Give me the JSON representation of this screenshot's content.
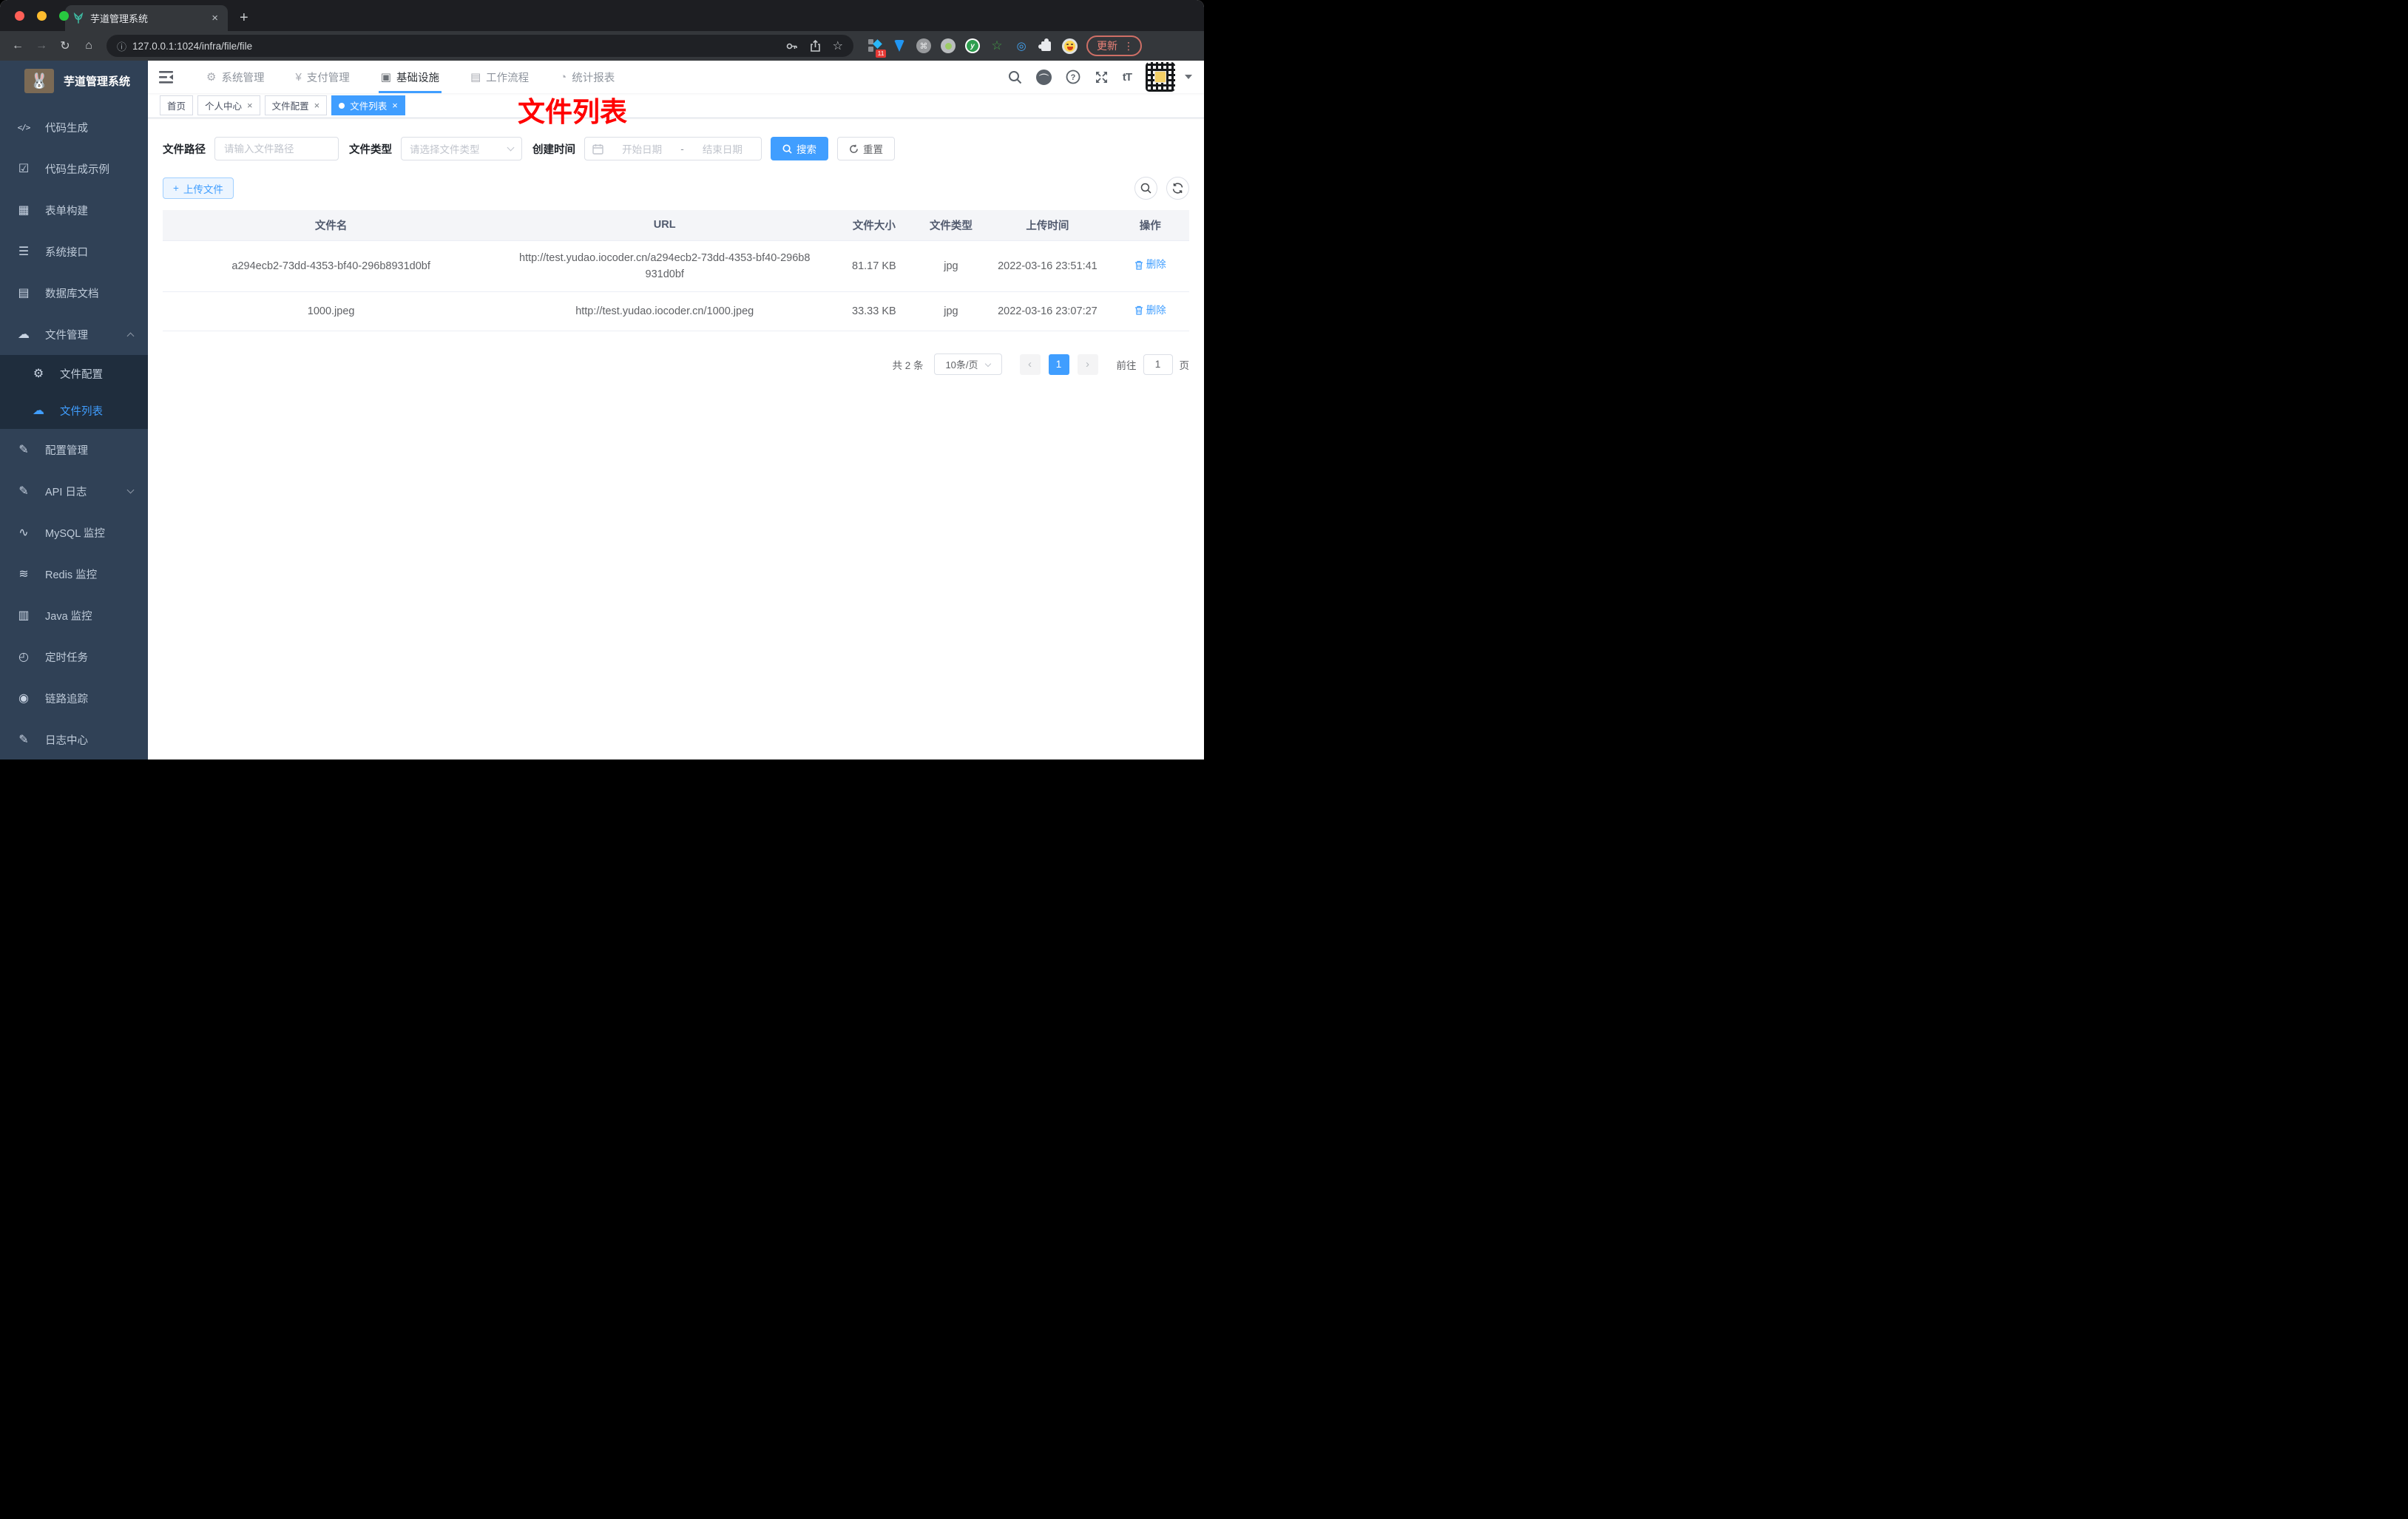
{
  "browser": {
    "tab": {
      "title": "芋道管理系统",
      "close": "×",
      "new_tab": "+"
    },
    "toolbar": {
      "back": "←",
      "forward": "→",
      "reload": "↻",
      "home": "⌂",
      "url": "127.0.0.1:1024/infra/file/file",
      "update_label": "更新",
      "menu_dots": "⋮",
      "extension_badge": "11",
      "cmd_glyph": "⌘",
      "star_glyph": "☆",
      "eye_glyph": "◎",
      "y_glyph": "y"
    }
  },
  "app": {
    "sidebar": {
      "title": "芋道管理系统",
      "items": [
        {
          "glyph": "</>",
          "label": "代码生成"
        },
        {
          "glyph": "☑",
          "label": "代码生成示例"
        },
        {
          "glyph": "▦",
          "label": "表单构建"
        },
        {
          "glyph": "☰",
          "label": "系统接口"
        },
        {
          "glyph": "▤",
          "label": "数据库文档"
        },
        {
          "glyph": "☁",
          "label": "文件管理"
        },
        {
          "glyph": "⚙",
          "label": "文件配置"
        },
        {
          "glyph": "☁",
          "label": "文件列表"
        },
        {
          "glyph": "✎",
          "label": "配置管理"
        },
        {
          "glyph": "✎",
          "label": "API 日志"
        },
        {
          "glyph": "∿",
          "label": "MySQL 监控"
        },
        {
          "glyph": "≋",
          "label": "Redis 监控"
        },
        {
          "glyph": "▥",
          "label": "Java 监控"
        },
        {
          "glyph": "◴",
          "label": "定时任务"
        },
        {
          "glyph": "◉",
          "label": "链路追踪"
        },
        {
          "glyph": "✎",
          "label": "日志中心"
        }
      ]
    },
    "header": {
      "nav": [
        {
          "glyph": "⚙",
          "label": "系统管理"
        },
        {
          "glyph": "¥",
          "label": "支付管理"
        },
        {
          "glyph": "▣",
          "label": "基础设施"
        },
        {
          "glyph": "▤",
          "label": "工作流程"
        },
        {
          "glyph": "◔",
          "label": "统计报表"
        }
      ],
      "fontsize_glyph": "tT"
    },
    "tags": {
      "items": [
        {
          "label": "首页"
        },
        {
          "label": "个人中心"
        },
        {
          "label": "文件配置"
        },
        {
          "label": "文件列表"
        }
      ],
      "close": "×"
    },
    "annotation": "文件列表",
    "filters": {
      "path_label": "文件路径",
      "path_placeholder": "请输入文件路径",
      "type_label": "文件类型",
      "type_placeholder": "请选择文件类型",
      "time_label": "创建时间",
      "start_placeholder": "开始日期",
      "separator": "-",
      "end_placeholder": "结束日期",
      "search_label": "搜索",
      "reset_label": "重置"
    },
    "toolbar": {
      "upload_label": "上传文件",
      "plus": "+"
    },
    "table": {
      "headers": [
        "文件名",
        "URL",
        "文件大小",
        "文件类型",
        "上传时间",
        "操作"
      ],
      "rows": [
        {
          "name": "a294ecb2-73dd-4353-bf40-296b8931d0bf",
          "url": "http://test.yudao.iocoder.cn/a294ecb2-73dd-4353-bf40-296b8931d0bf",
          "size": "81.17 KB",
          "type": "jpg",
          "time": "2022-03-16 23:51:41",
          "action": "删除"
        },
        {
          "name": "1000.jpeg",
          "url": "http://test.yudao.iocoder.cn/1000.jpeg",
          "size": "33.33 KB",
          "type": "jpg",
          "time": "2022-03-16 23:07:27",
          "action": "删除"
        }
      ]
    },
    "pagination": {
      "total": "共 2 条",
      "page_size": "10条/页",
      "prev": "‹",
      "current": "1",
      "next": "›",
      "goto_label": "前往",
      "goto_value": "1",
      "unit_label": "页"
    }
  },
  "colors": {
    "accent": "#409eff",
    "sidebar_bg": "#304156",
    "submenu_bg": "#1f2d3d",
    "annotation_red": "#ff0000"
  }
}
